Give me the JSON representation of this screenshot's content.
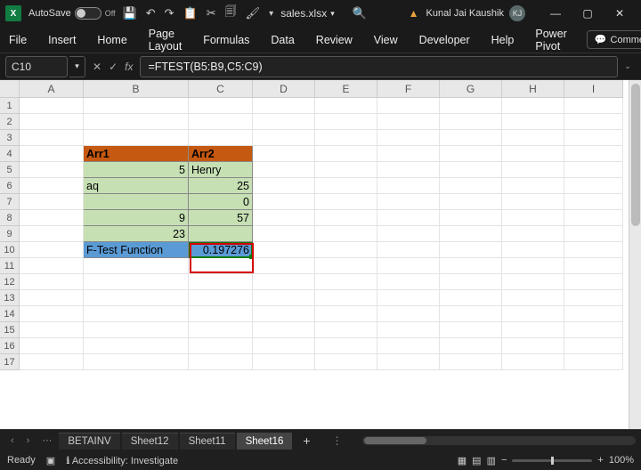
{
  "titlebar": {
    "autosave_label": "AutoSave",
    "autosave_state": "Off",
    "filename": "sales.xlsx",
    "user_name": "Kunal Jai Kaushik",
    "user_initials": "KJ"
  },
  "ribbon": {
    "tabs": [
      "File",
      "Insert",
      "Home",
      "Page Layout",
      "Formulas",
      "Data",
      "Review",
      "View",
      "Developer",
      "Help",
      "Power Pivot"
    ],
    "comments": "Comments"
  },
  "formula_bar": {
    "cell_ref": "C10",
    "formula": "=FTEST(B5:B9,C5:C9)"
  },
  "columns": [
    "A",
    "B",
    "C",
    "D",
    "E",
    "F",
    "G",
    "H",
    "I"
  ],
  "row_count": 17,
  "table": {
    "headers": {
      "b": "Arr1",
      "c": "Arr2"
    },
    "rows": [
      {
        "b": "5",
        "c": "Henry",
        "b_align": "r",
        "c_align": "l"
      },
      {
        "b": "aq",
        "c": "25",
        "b_align": "l",
        "c_align": "r"
      },
      {
        "b": "",
        "c": "0",
        "b_align": "l",
        "c_align": "r"
      },
      {
        "b": "9",
        "c": "57",
        "b_align": "r",
        "c_align": "r"
      },
      {
        "b": "23",
        "c": "",
        "b_align": "r",
        "c_align": "r"
      }
    ],
    "footer": {
      "b": "F-Test Function",
      "c": "0.197276"
    }
  },
  "sheets": {
    "tabs": [
      "BETAINV",
      "Sheet12",
      "Sheet11",
      "Sheet16"
    ],
    "active": "Sheet16"
  },
  "status": {
    "ready": "Ready",
    "accessibility": "Accessibility: Investigate",
    "zoom": "100%"
  }
}
